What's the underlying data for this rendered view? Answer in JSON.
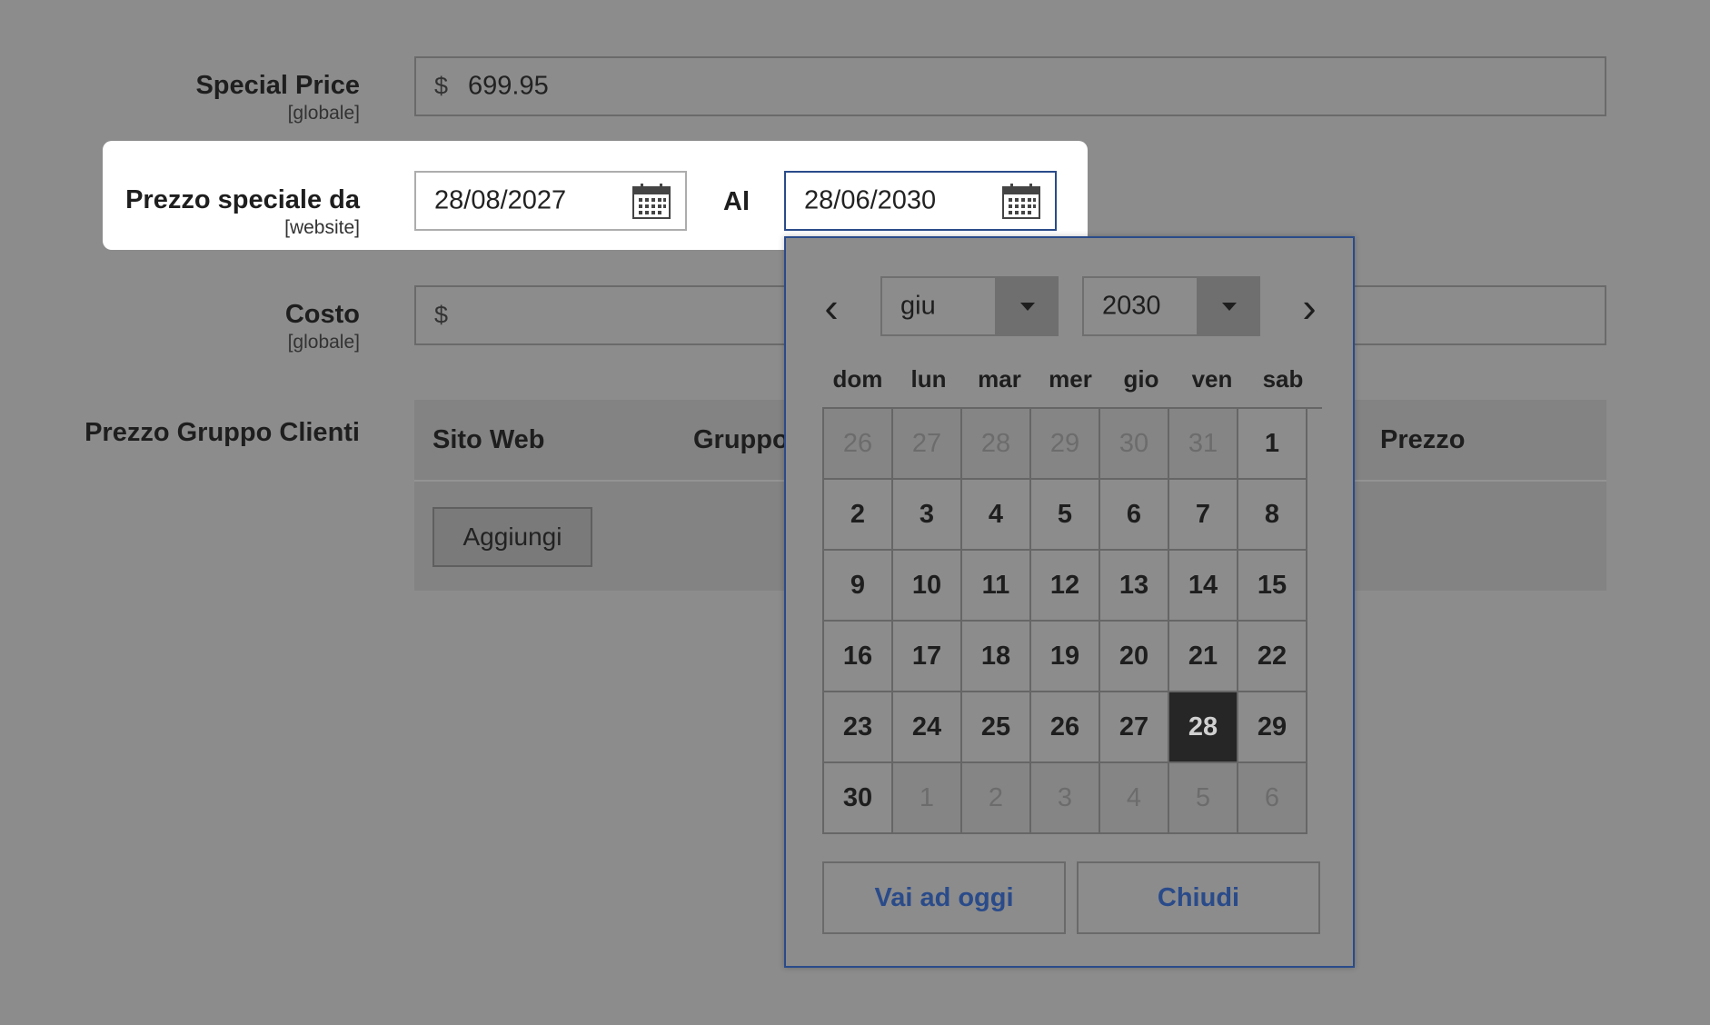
{
  "special_price": {
    "label": "Special Price",
    "scope": "[globale]",
    "currency": "$",
    "value": "699.95"
  },
  "special_from": {
    "label": "Prezzo speciale da",
    "scope": "[website]",
    "from_value": "28/08/2027",
    "to_label": "Al",
    "to_value": "28/06/2030"
  },
  "cost": {
    "label": "Costo",
    "scope": "[globale]",
    "currency": "$"
  },
  "tier_price": {
    "label": "Prezzo Gruppo Clienti",
    "columns": {
      "website": "Sito Web",
      "group": "Gruppo",
      "price": "Prezzo"
    },
    "add_button": "Aggiungi"
  },
  "calendar": {
    "prev_icon": "chevron-left-icon",
    "next_icon": "chevron-right-icon",
    "month": "giu",
    "year": "2030",
    "weekdays": [
      "dom",
      "lun",
      "mar",
      "mer",
      "gio",
      "ven",
      "sab"
    ],
    "days": [
      {
        "d": "26",
        "other": true
      },
      {
        "d": "27",
        "other": true
      },
      {
        "d": "28",
        "other": true
      },
      {
        "d": "29",
        "other": true
      },
      {
        "d": "30",
        "other": true
      },
      {
        "d": "31",
        "other": true
      },
      {
        "d": "1"
      },
      {
        "d": "2"
      },
      {
        "d": "3"
      },
      {
        "d": "4"
      },
      {
        "d": "5"
      },
      {
        "d": "6"
      },
      {
        "d": "7"
      },
      {
        "d": "8"
      },
      {
        "d": "9"
      },
      {
        "d": "10"
      },
      {
        "d": "11"
      },
      {
        "d": "12"
      },
      {
        "d": "13"
      },
      {
        "d": "14"
      },
      {
        "d": "15"
      },
      {
        "d": "16"
      },
      {
        "d": "17"
      },
      {
        "d": "18"
      },
      {
        "d": "19"
      },
      {
        "d": "20"
      },
      {
        "d": "21"
      },
      {
        "d": "22"
      },
      {
        "d": "23"
      },
      {
        "d": "24"
      },
      {
        "d": "25"
      },
      {
        "d": "26"
      },
      {
        "d": "27"
      },
      {
        "d": "28",
        "selected": true
      },
      {
        "d": "29"
      },
      {
        "d": "30"
      },
      {
        "d": "1",
        "other": true
      },
      {
        "d": "2",
        "other": true
      },
      {
        "d": "3",
        "other": true
      },
      {
        "d": "4",
        "other": true
      },
      {
        "d": "5",
        "other": true
      },
      {
        "d": "6",
        "other": true
      }
    ],
    "today_button": "Vai ad oggi",
    "close_button": "Chiudi"
  },
  "colors": {
    "accent": "#2a4b8a",
    "selected_day": "#262626",
    "overlay": "#8c8c8c"
  }
}
